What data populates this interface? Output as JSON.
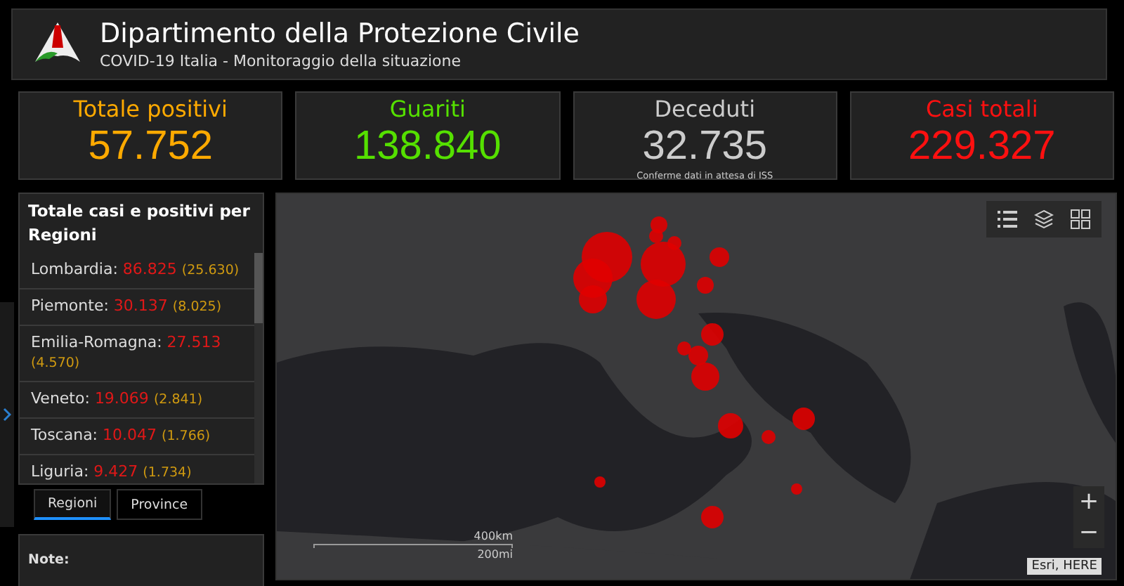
{
  "header": {
    "title": "Dipartimento della Protezione Civile",
    "subtitle": "COVID-19 Italia - Monitoraggio della situazione"
  },
  "cards": [
    {
      "label": "Totale positivi",
      "value": "57.752",
      "color": "#ffaa00"
    },
    {
      "label": "Guariti",
      "value": "138.840",
      "color": "#55e000"
    },
    {
      "label": "Deceduti",
      "value": "32.735",
      "color": "#cccccc",
      "note": "Conferme dati in attesa di ISS"
    },
    {
      "label": "Casi totali",
      "value": "229.327",
      "color": "#ff1010"
    }
  ],
  "regions": {
    "title": "Totale casi e positivi per Regioni",
    "rows": [
      {
        "name": "Lombardia:",
        "total": "86.825",
        "positive": "(25.630)"
      },
      {
        "name": "Piemonte:",
        "total": "30.137",
        "positive": "(8.025)"
      },
      {
        "name": "Emilia-Romagna:",
        "total": "27.513",
        "positive": "(4.570)"
      },
      {
        "name": "Veneto:",
        "total": "19.069",
        "positive": "(2.841)"
      },
      {
        "name": "Toscana:",
        "total": "10.047",
        "positive": "(1.766)"
      },
      {
        "name": "Liguria:",
        "total": "9.427",
        "positive": "(1.734)"
      }
    ],
    "tabs": [
      {
        "label": "Regioni",
        "selected": true
      },
      {
        "label": "Province",
        "selected": false
      }
    ]
  },
  "notes": {
    "title": "Note:"
  },
  "map": {
    "kind": "picture",
    "scale_km": "400km",
    "scale_mi": "200mi",
    "zoom_in": "+",
    "zoom_out": "−",
    "attribution": "Esri, HERE"
  }
}
